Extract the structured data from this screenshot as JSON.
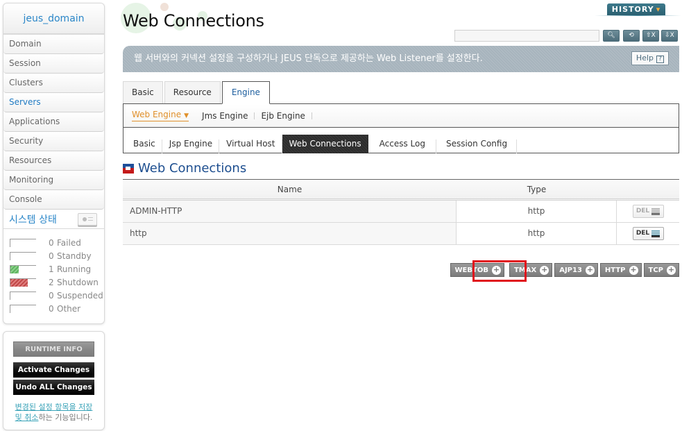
{
  "sidebar": {
    "domain": "jeus_domain",
    "nav": [
      "Domain",
      "Session",
      "Clusters",
      "Servers",
      "Applications",
      "Security",
      "Resources",
      "Monitoring",
      "Console"
    ],
    "active_nav": "Servers",
    "status": {
      "title": "시스템 상태",
      "rows": [
        {
          "count": "0",
          "label": "Failed",
          "fraction": 0,
          "color": "none"
        },
        {
          "count": "0",
          "label": "Standby",
          "fraction": 0,
          "color": "none"
        },
        {
          "count": "1",
          "label": "Running",
          "fraction": 0.33,
          "color": "green"
        },
        {
          "count": "2",
          "label": "Shutdown",
          "fraction": 0.67,
          "color": "red"
        },
        {
          "count": "0",
          "label": "Suspended",
          "fraction": 0,
          "color": "none"
        },
        {
          "count": "0",
          "label": "Other",
          "fraction": 0,
          "color": "none"
        }
      ]
    },
    "runtime_info": "RUNTIME INFO",
    "activate_changes": "Activate Changes",
    "undo_all_changes": "Undo ALL Changes",
    "help_link": "변경된 설정 항목을 저장 및 취소",
    "help_suffix": "하는 기능입니다."
  },
  "header": {
    "title": "Web Connections",
    "history": "HISTORY",
    "search_value": "",
    "tools": [
      "search",
      "refresh",
      "xml-export",
      "xml-import"
    ]
  },
  "banner": {
    "text": "웹 서버와의 커넥션 설정을 구성하거나 JEUS 단독으로 제공하는 Web Listener를 설정한다.",
    "help": "Help",
    "help_q": "?"
  },
  "tabs": {
    "level1": [
      "Basic",
      "Resource",
      "Engine"
    ],
    "level1_active": "Engine",
    "level2": [
      "Web Engine",
      "Jms Engine",
      "Ejb Engine"
    ],
    "level2_active": "Web Engine",
    "level3": [
      "Basic",
      "Jsp Engine",
      "Virtual Host",
      "Web Connections",
      "Access Log",
      "Session Config"
    ],
    "level3_active": "Web Connections"
  },
  "section": {
    "title": "Web Connections",
    "columns": [
      "Name",
      "Type"
    ],
    "rows": [
      {
        "name": "ADMIN-HTTP",
        "type": "http",
        "del": "DEL",
        "del_enabled": false
      },
      {
        "name": "http",
        "type": "http",
        "del": "DEL",
        "del_enabled": true
      }
    ],
    "add_buttons": [
      "WEBTOB",
      "TMAX",
      "AJP13",
      "HTTP",
      "TCP"
    ],
    "highlighted": "WEBTOB"
  },
  "colors": {
    "accent_blue": "#2a86c8",
    "title_blue": "#1d4e8f",
    "orange": "#e0902a",
    "highlight_red": "#e0121b"
  }
}
